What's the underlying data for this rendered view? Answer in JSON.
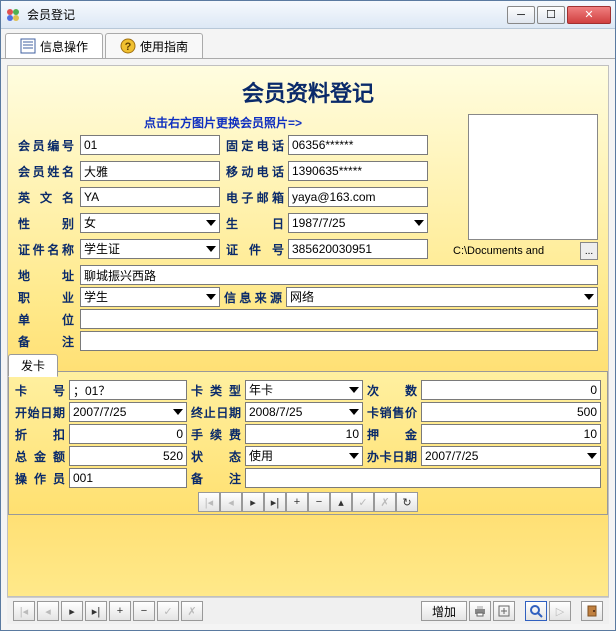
{
  "window": {
    "title": "会员登记"
  },
  "tabs": {
    "info": "信息操作",
    "guide": "使用指南"
  },
  "panel": {
    "title": "会员资料登记",
    "hint": "点击右方图片更换会员照片=>"
  },
  "photo": {
    "path": "C:\\Documents and",
    "browse": "..."
  },
  "labels": {
    "member_no": "会员编号",
    "fixed_phone": "固定电话",
    "member_name": "会员姓名",
    "mobile": "移动电话",
    "en_name": "英 文 名",
    "email": "电子邮箱",
    "gender": "性    别",
    "birthday": "生    日",
    "cert_name": "证件名称",
    "cert_no": "证 件 号",
    "address": "地    址",
    "job": "职    业",
    "info_src": "信息来源",
    "company": "单    位",
    "remark": "备    注"
  },
  "fields": {
    "member_no": "01",
    "fixed_phone": "06356******",
    "member_name": "大雅",
    "mobile": "1390635*****",
    "en_name": "YA",
    "email": "yaya@163.com",
    "gender": "女",
    "birthday": "1987/7/25",
    "cert_name": "学生证",
    "cert_no": "385620030951",
    "address": "聊城振兴西路",
    "job": "学生",
    "info_src": "网络",
    "company": "",
    "remark": ""
  },
  "faka": {
    "tab": "发卡",
    "labels": {
      "card_no": "卡   号",
      "card_type": "卡 类 型",
      "times": "次    数",
      "start": "开始日期",
      "end": "终止日期",
      "price": "卡销售价",
      "discount": "折    扣",
      "fee": "手 续 费",
      "deposit": "押    金",
      "total": "总 金 额",
      "status": "状    态",
      "card_date": "办卡日期",
      "operator": "操 作 员",
      "remark": "备    注"
    },
    "fields": {
      "card_no": "；01？",
      "card_type": "年卡",
      "times": "0",
      "start": "2007/7/25",
      "end": "2008/7/25",
      "price": "500",
      "discount": "0",
      "fee": "10",
      "deposit": "10",
      "total": "520",
      "status": "使用",
      "card_date": "2007/7/25",
      "operator": "001",
      "remark": ""
    }
  },
  "bottom": {
    "add": "增加"
  },
  "nav_icons": {
    "first": "|◂",
    "prev": "◂",
    "next": "▸",
    "last": "▸|",
    "plus": "+",
    "minus": "−",
    "edit": "▴",
    "check": "✓",
    "cancel": "✗",
    "refresh": "↻"
  }
}
